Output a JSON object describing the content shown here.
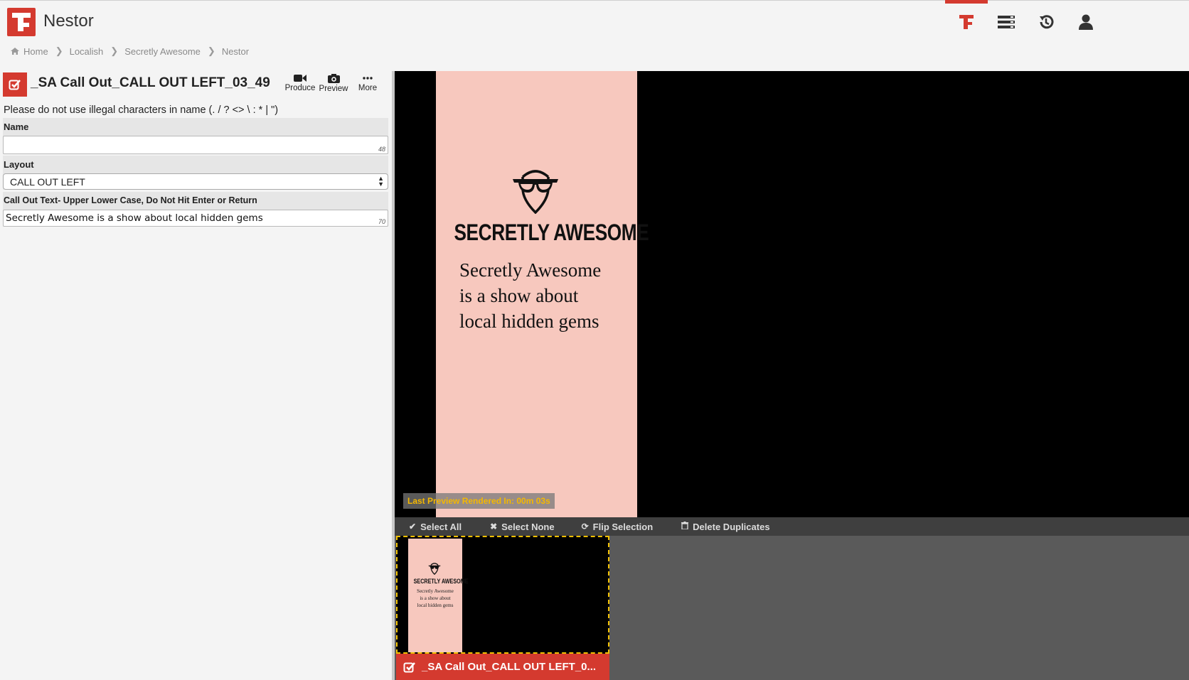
{
  "app": {
    "title": "Nestor"
  },
  "breadcrumb": [
    "Home",
    "Localish",
    "Secretly Awesome",
    "Nestor"
  ],
  "asset": {
    "title": "_SA Call Out_CALL OUT LEFT_03_49",
    "tools": {
      "produce": "Produce",
      "preview": "Preview",
      "more": "More"
    }
  },
  "form": {
    "warning": "Please do not use illegal characters in name (. / ? <> \\ : * | \")",
    "name": {
      "label": "Name",
      "value": "",
      "max": "48"
    },
    "layout": {
      "label": "Layout",
      "value": "CALL OUT LEFT"
    },
    "callout": {
      "label": "Call Out Text- Upper Lower Case, Do Not Hit Enter or Return",
      "value": "Secretly Awesome is a show about local hidden gems",
      "max": "70"
    }
  },
  "preview": {
    "brand": "SECRETLY AWESOME",
    "lines": [
      "Secretly Awesome",
      "is a show about",
      "local hidden gems"
    ],
    "render_time": "Last Preview Rendered In: 00m 03s"
  },
  "selection": {
    "select_all": "Select All",
    "select_none": "Select None",
    "flip": "Flip Selection",
    "delete_duplicates": "Delete Duplicates"
  },
  "thumbnail": {
    "label": "_SA Call Out_CALL OUT LEFT_0..."
  },
  "colors": {
    "accent": "#d43a2f",
    "poster": "#f7c8be",
    "dashed": "#f0c000",
    "render_text": "#f5b800"
  },
  "icons": [
    "brand-logo-icon",
    "list-icon",
    "history-icon",
    "user-icon",
    "home-icon",
    "checkbox-icon",
    "video-camera-icon",
    "camera-icon",
    "ellipsis-icon",
    "check-icon",
    "close-icon",
    "refresh-icon",
    "trash-icon"
  ]
}
